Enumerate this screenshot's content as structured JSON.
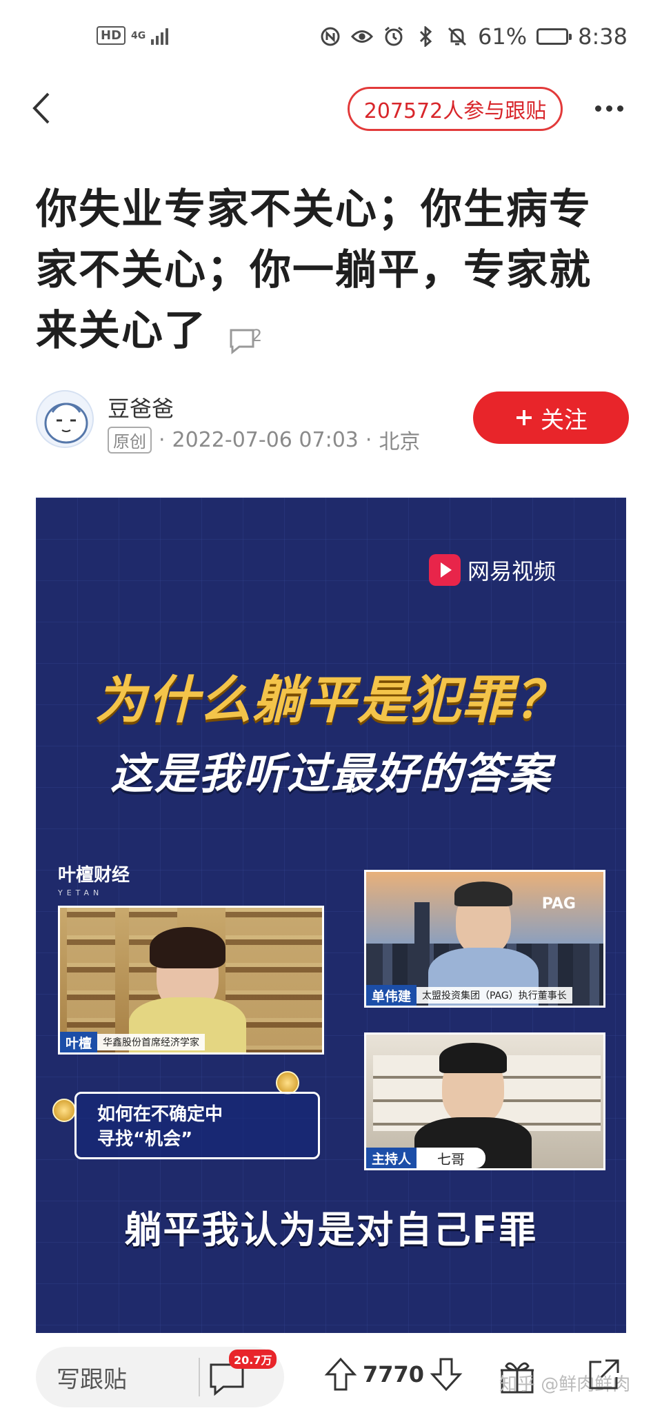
{
  "status_bar": {
    "hd_label": "HD",
    "network": "4G",
    "battery_percent": 61,
    "battery_text": "61%",
    "time": "8:38"
  },
  "nav": {
    "follow_count_text": "207572人参与跟贴"
  },
  "article": {
    "title": "你失业专家不关心；你生病专家不关心；你一躺平，专家就来关心了",
    "comment_count": "2",
    "author": "豆爸爸",
    "original_tag": "原创",
    "datetime": "2022-07-06 07:03",
    "location": "北京",
    "follow_button": "关注",
    "follow_icon": "plus-icon"
  },
  "media": {
    "logo_text": "网易视频",
    "headline1": "为什么躺平是犯罪？",
    "headline2": "这是我听过最好的答案",
    "brand": "叶檀财经",
    "brand_sub": "YETAN",
    "speaker1_name": "叶檀",
    "speaker1_title": "华鑫股份首席经济学家",
    "speaker2_name": "单伟建",
    "speaker2_title": "太盟投资集团（PAG）执行董事长",
    "speaker2_logo": "PAG",
    "host_label": "主持人",
    "host_name": "七哥",
    "chance_line1": "如何在不确定中",
    "chance_line2": "寻找“机会”",
    "subtitle": "躺平我认为是对自己F罪"
  },
  "bottom_bar": {
    "reply_placeholder": "写跟贴",
    "comment_badge": "20.7万",
    "vote_count": "7770",
    "watermark": "知乎 @鲜肉鲜肉"
  },
  "colors": {
    "accent_red": "#e8252a",
    "media_bg": "#1f2a6b",
    "headline_gold": "#f4c44a"
  }
}
